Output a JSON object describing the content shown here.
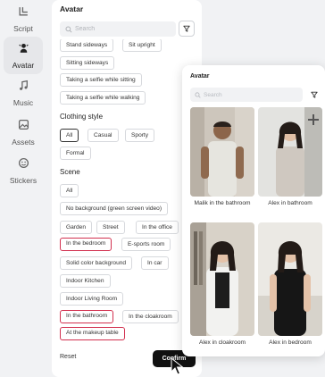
{
  "sidebar": {
    "items": [
      {
        "label": "Script",
        "icon": "script-icon"
      },
      {
        "label": "Avatar",
        "icon": "avatar-icon"
      },
      {
        "label": "Music",
        "icon": "music-icon"
      },
      {
        "label": "Assets",
        "icon": "assets-icon"
      },
      {
        "label": "Stickers",
        "icon": "stickers-icon"
      }
    ],
    "active": "Avatar"
  },
  "panel": {
    "title": "Avatar",
    "search_placeholder": "Search",
    "pose_tags": [
      "Stand sideways",
      "Sit upright",
      "Sitting sideways",
      "Taking a selfie while sitting",
      "Taking a selfie while walking"
    ],
    "clothing_title": "Clothing style",
    "clothing_tags": [
      "All",
      "Casual",
      "Sporty",
      "Formal"
    ],
    "scene_title": "Scene",
    "scene_tags": [
      "All",
      "No background (green screen video)",
      "Garden",
      "Street",
      "In the office",
      "In the bedroom",
      "E-sports room",
      "Solid color background",
      "In car",
      "Indoor Kitchen",
      "Indoor Living Room",
      "In the bathroom",
      "In the cloakroom",
      "At the makeup table"
    ],
    "reset_label": "Reset",
    "confirm_label": "Confirm"
  },
  "preview": {
    "title": "Avatar",
    "search_placeholder": "Search",
    "cards": [
      "Malik in the bathroom",
      "Alex in bathroom",
      "Alex in cloakroom",
      "Alex in bedroom"
    ]
  },
  "colors": {
    "accent": "#d2304f",
    "confirm_bg": "#111111",
    "panel_bg": "#ffffff",
    "page_bg": "#f1f2f4"
  }
}
